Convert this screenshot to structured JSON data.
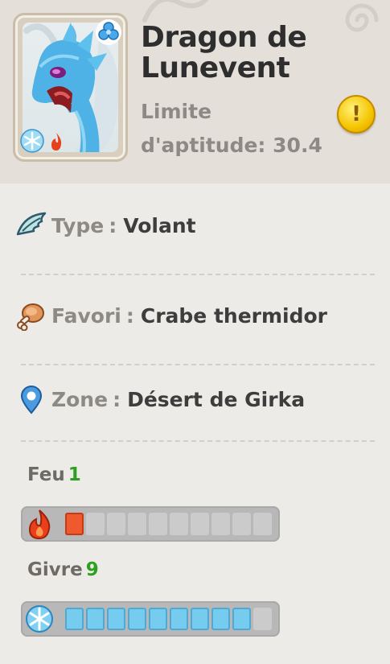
{
  "creature": {
    "name": "Dragon de Lunevent",
    "aptitude_label": "Limite d'aptitude:",
    "aptitude_value": "30.4"
  },
  "details": {
    "type_label": "Type",
    "type_value": "Volant",
    "favorite_label": "Favori",
    "favorite_value": "Crabe thermidor",
    "zone_label": "Zone",
    "zone_value": "Désert de Girka",
    "separator": ":"
  },
  "stats": {
    "fire": {
      "label": "Feu",
      "value": "1",
      "filled": 1,
      "max": 10
    },
    "ice": {
      "label": "Givre",
      "value": "9",
      "filled": 9,
      "max": 10
    }
  },
  "colors": {
    "stat_number": "#2ea01f",
    "fire_segment": "#ee5a2e",
    "ice_segment": "#75ccef",
    "alert": "#f5c400"
  },
  "icons": {
    "portrait_badge": "clover-icon",
    "alert": "exclamation-icon",
    "type": "wing-icon",
    "favorite": "meat-icon",
    "zone": "location-pin-icon",
    "fire": "flame-icon",
    "ice": "snowflake-icon"
  }
}
